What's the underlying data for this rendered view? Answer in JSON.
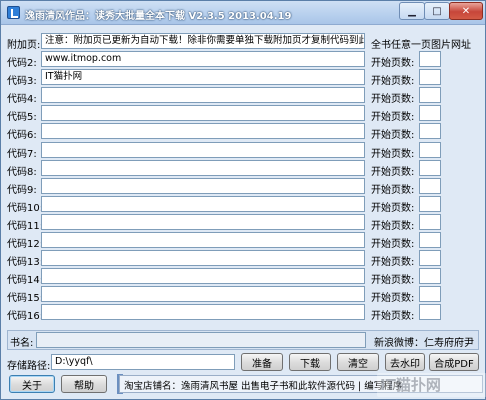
{
  "window": {
    "title": "逸雨清风作品：读秀大批量全本下载 V2.3.5  2013.04.19",
    "min_glyph": "▁",
    "max_glyph": "□",
    "close_glyph": "✕"
  },
  "form": {
    "attach_label": "附加页:",
    "attach_value": "注意：附加页已更新为自动下载！除非你需要单独下载附加页才复制代码到此",
    "right_header": "全书任意一页图片网址",
    "start_page_label": "开始页数:",
    "code_rows": [
      {
        "label": "代码2:",
        "value": "www.itmop.com"
      },
      {
        "label": "代码3:",
        "value": "IT猫扑网"
      },
      {
        "label": "代码4:",
        "value": ""
      },
      {
        "label": "代码5:",
        "value": ""
      },
      {
        "label": "代码6:",
        "value": ""
      },
      {
        "label": "代码7:",
        "value": ""
      },
      {
        "label": "代码8:",
        "value": ""
      },
      {
        "label": "代码9:",
        "value": ""
      },
      {
        "label": "代码10:",
        "value": ""
      },
      {
        "label": "代码11:",
        "value": ""
      },
      {
        "label": "代码12:",
        "value": ""
      },
      {
        "label": "代码13:",
        "value": ""
      },
      {
        "label": "代码14:",
        "value": ""
      },
      {
        "label": "代码15:",
        "value": ""
      },
      {
        "label": "代码16:",
        "value": ""
      }
    ],
    "book_label": "书名:",
    "weibo": "新浪微博：仁寿府府尹",
    "save_path_label": "存储路径:",
    "save_path_value": "D:\\yyqf\\"
  },
  "buttons": {
    "prepare": "准备",
    "download": "下载",
    "clear": "清空",
    "remove_watermark": "去水印",
    "merge_pdf": "合成PDF",
    "about": "关于",
    "help": "帮助"
  },
  "status": {
    "text": "淘宝店铺名：逸雨清风书屋  出售电子书和此软件源代码 | 编写程序   "
  },
  "watermark": {
    "text": "IT猫扑网"
  }
}
